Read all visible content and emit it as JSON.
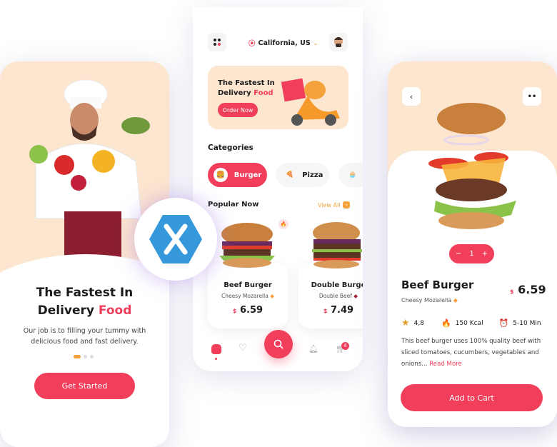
{
  "colors": {
    "accent": "#f03e5b",
    "peach": "#fde6cf",
    "orange": "#f6a23c",
    "xamarin": "#3498db"
  },
  "onboarding": {
    "title_line1": "The Fastest In",
    "title_line2_prefix": "Delivery ",
    "title_highlight": "Food",
    "description_line1": "Our job is to filling your tummy with",
    "description_line2": "delicious food and fast delivery.",
    "page_count": 3,
    "active_page": 1,
    "cta_label": "Get Started"
  },
  "home": {
    "location": "California, US",
    "banner": {
      "line1": "The Fastest In",
      "line2_prefix": "Delivery ",
      "line2_highlight": "Food",
      "button": "Order Now"
    },
    "categories_title": "Categories",
    "categories": [
      {
        "label": "Burger",
        "icon": "burger-icon",
        "active": true
      },
      {
        "label": "Pizza",
        "icon": "pizza-icon",
        "active": false
      },
      {
        "label": "",
        "icon": "cupcake-icon",
        "active": false
      }
    ],
    "popular_title": "Popular Now",
    "view_all": "View All",
    "items": [
      {
        "name": "Beef Burger",
        "subtitle": "Cheesy Mozarella",
        "currency": "$",
        "price": "6.59"
      },
      {
        "name": "Double Burge",
        "subtitle": "Double Beef",
        "currency": "$",
        "price": "7.49"
      }
    ],
    "cart_count": "4"
  },
  "detail": {
    "quantity": "1",
    "name": "Beef Burger",
    "subtitle": "Cheesy Mozarella",
    "currency": "$",
    "price": "6.59",
    "rating": "4,8",
    "calories": "150 Kcal",
    "time": "5-10 Min",
    "description": "This beef burger uses 100% quality beef with sliced tomatoes, cucumbers, vegetables and onions... ",
    "read_more": "Read More",
    "cta_label": "Add to Cart"
  }
}
